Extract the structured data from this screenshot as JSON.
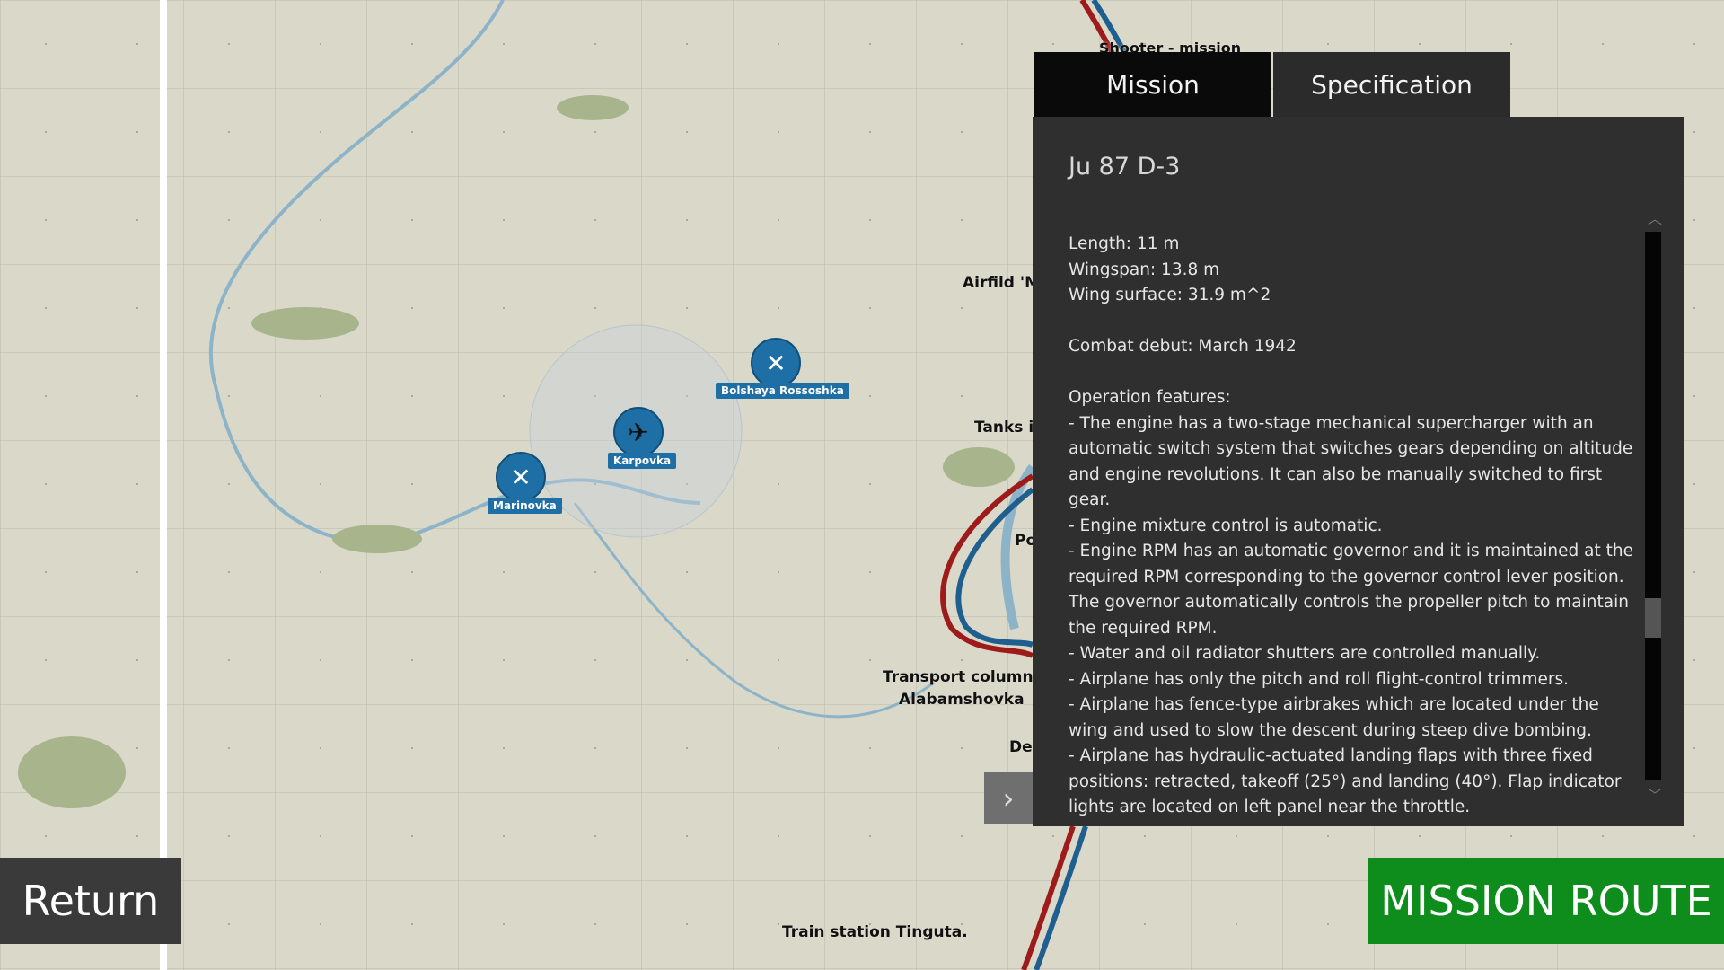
{
  "map": {
    "header_label": "Shooter - mission",
    "places": {
      "marinovka": "Marinovka",
      "karpovka": "Karpovka",
      "bolshaya": "Bolshaya Rossoshka",
      "airfield": "Airfild 'Ma",
      "tanks": "Tanks in",
      "po": "Po",
      "transport_line1": "Transport column in",
      "transport_line2": "Alabamshovka",
      "dep": "Dep",
      "train": "Train station Tinguta."
    }
  },
  "tabs": {
    "mission": "Mission",
    "specification": "Specification"
  },
  "panel": {
    "title": "Ju 87 D-3",
    "length": "Length: 11 m",
    "wingspan": "Wingspan: 13.8 m",
    "wing_surface": "Wing surface: 31.9 m^2",
    "combat_debut": "Combat debut: March 1942",
    "features_header": "Operation features:",
    "features": [
      "- The engine has a two-stage mechanical supercharger with an automatic switch system that switches gears depending on altitude and engine revolutions. It can also be manually switched to first gear.",
      "- Engine mixture control is automatic.",
      "- Engine RPM has an automatic governor and it is maintained at the required RPM corresponding to the governor control lever position. The governor automatically controls the propeller pitch to maintain the required RPM.",
      "- Water and oil radiator shutters are controlled manually.",
      "- Airplane has only the pitch and roll flight-control trimmers.",
      "- Airplane has fence-type airbrakes which are located under the wing and used to slow the descent during steep dive bombing.",
      "- Airplane has hydraulic-actuated landing flaps with three fixed positions: retracted, takeoff (25°) and landing (40°). Flap indicator lights are located on left panel near the throttle."
    ],
    "scroll_position": 0.72
  },
  "buttons": {
    "return": "Return",
    "mission_route": "MISSION ROUTE"
  },
  "colors": {
    "panel_bg": "#2f2f2f",
    "route_green": "#0e8d1c",
    "marker_blue": "#1e6fa5",
    "route_red": "#9e1b1b",
    "route_blue": "#1f5f8f"
  },
  "icons": {
    "marker_airfield": "crossed-planes-icon",
    "marker_aircraft": "plane-icon",
    "toggle": "chevron-right-icon"
  }
}
